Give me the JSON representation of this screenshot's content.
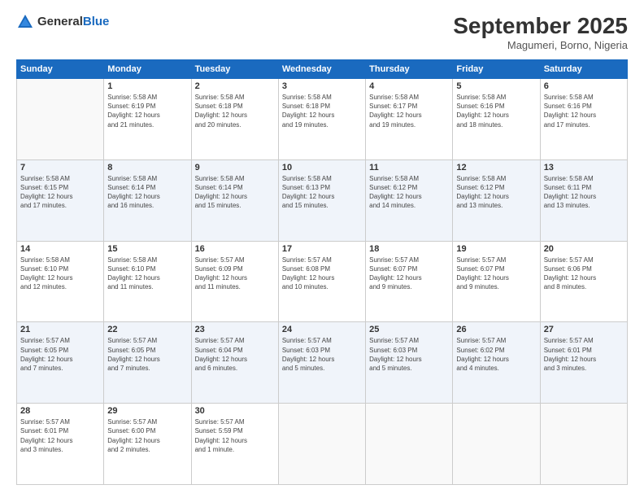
{
  "header": {
    "logo_general": "General",
    "logo_blue": "Blue",
    "month_title": "September 2025",
    "location": "Magumeri, Borno, Nigeria"
  },
  "days_of_week": [
    "Sunday",
    "Monday",
    "Tuesday",
    "Wednesday",
    "Thursday",
    "Friday",
    "Saturday"
  ],
  "weeks": [
    [
      {
        "day": "",
        "content": ""
      },
      {
        "day": "1",
        "content": "Sunrise: 5:58 AM\nSunset: 6:19 PM\nDaylight: 12 hours\nand 21 minutes."
      },
      {
        "day": "2",
        "content": "Sunrise: 5:58 AM\nSunset: 6:18 PM\nDaylight: 12 hours\nand 20 minutes."
      },
      {
        "day": "3",
        "content": "Sunrise: 5:58 AM\nSunset: 6:18 PM\nDaylight: 12 hours\nand 19 minutes."
      },
      {
        "day": "4",
        "content": "Sunrise: 5:58 AM\nSunset: 6:17 PM\nDaylight: 12 hours\nand 19 minutes."
      },
      {
        "day": "5",
        "content": "Sunrise: 5:58 AM\nSunset: 6:16 PM\nDaylight: 12 hours\nand 18 minutes."
      },
      {
        "day": "6",
        "content": "Sunrise: 5:58 AM\nSunset: 6:16 PM\nDaylight: 12 hours\nand 17 minutes."
      }
    ],
    [
      {
        "day": "7",
        "content": "Sunrise: 5:58 AM\nSunset: 6:15 PM\nDaylight: 12 hours\nand 17 minutes."
      },
      {
        "day": "8",
        "content": "Sunrise: 5:58 AM\nSunset: 6:14 PM\nDaylight: 12 hours\nand 16 minutes."
      },
      {
        "day": "9",
        "content": "Sunrise: 5:58 AM\nSunset: 6:14 PM\nDaylight: 12 hours\nand 15 minutes."
      },
      {
        "day": "10",
        "content": "Sunrise: 5:58 AM\nSunset: 6:13 PM\nDaylight: 12 hours\nand 15 minutes."
      },
      {
        "day": "11",
        "content": "Sunrise: 5:58 AM\nSunset: 6:12 PM\nDaylight: 12 hours\nand 14 minutes."
      },
      {
        "day": "12",
        "content": "Sunrise: 5:58 AM\nSunset: 6:12 PM\nDaylight: 12 hours\nand 13 minutes."
      },
      {
        "day": "13",
        "content": "Sunrise: 5:58 AM\nSunset: 6:11 PM\nDaylight: 12 hours\nand 13 minutes."
      }
    ],
    [
      {
        "day": "14",
        "content": "Sunrise: 5:58 AM\nSunset: 6:10 PM\nDaylight: 12 hours\nand 12 minutes."
      },
      {
        "day": "15",
        "content": "Sunrise: 5:58 AM\nSunset: 6:10 PM\nDaylight: 12 hours\nand 11 minutes."
      },
      {
        "day": "16",
        "content": "Sunrise: 5:57 AM\nSunset: 6:09 PM\nDaylight: 12 hours\nand 11 minutes."
      },
      {
        "day": "17",
        "content": "Sunrise: 5:57 AM\nSunset: 6:08 PM\nDaylight: 12 hours\nand 10 minutes."
      },
      {
        "day": "18",
        "content": "Sunrise: 5:57 AM\nSunset: 6:07 PM\nDaylight: 12 hours\nand 9 minutes."
      },
      {
        "day": "19",
        "content": "Sunrise: 5:57 AM\nSunset: 6:07 PM\nDaylight: 12 hours\nand 9 minutes."
      },
      {
        "day": "20",
        "content": "Sunrise: 5:57 AM\nSunset: 6:06 PM\nDaylight: 12 hours\nand 8 minutes."
      }
    ],
    [
      {
        "day": "21",
        "content": "Sunrise: 5:57 AM\nSunset: 6:05 PM\nDaylight: 12 hours\nand 7 minutes."
      },
      {
        "day": "22",
        "content": "Sunrise: 5:57 AM\nSunset: 6:05 PM\nDaylight: 12 hours\nand 7 minutes."
      },
      {
        "day": "23",
        "content": "Sunrise: 5:57 AM\nSunset: 6:04 PM\nDaylight: 12 hours\nand 6 minutes."
      },
      {
        "day": "24",
        "content": "Sunrise: 5:57 AM\nSunset: 6:03 PM\nDaylight: 12 hours\nand 5 minutes."
      },
      {
        "day": "25",
        "content": "Sunrise: 5:57 AM\nSunset: 6:03 PM\nDaylight: 12 hours\nand 5 minutes."
      },
      {
        "day": "26",
        "content": "Sunrise: 5:57 AM\nSunset: 6:02 PM\nDaylight: 12 hours\nand 4 minutes."
      },
      {
        "day": "27",
        "content": "Sunrise: 5:57 AM\nSunset: 6:01 PM\nDaylight: 12 hours\nand 3 minutes."
      }
    ],
    [
      {
        "day": "28",
        "content": "Sunrise: 5:57 AM\nSunset: 6:01 PM\nDaylight: 12 hours\nand 3 minutes."
      },
      {
        "day": "29",
        "content": "Sunrise: 5:57 AM\nSunset: 6:00 PM\nDaylight: 12 hours\nand 2 minutes."
      },
      {
        "day": "30",
        "content": "Sunrise: 5:57 AM\nSunset: 5:59 PM\nDaylight: 12 hours\nand 1 minute."
      },
      {
        "day": "",
        "content": ""
      },
      {
        "day": "",
        "content": ""
      },
      {
        "day": "",
        "content": ""
      },
      {
        "day": "",
        "content": ""
      }
    ]
  ]
}
